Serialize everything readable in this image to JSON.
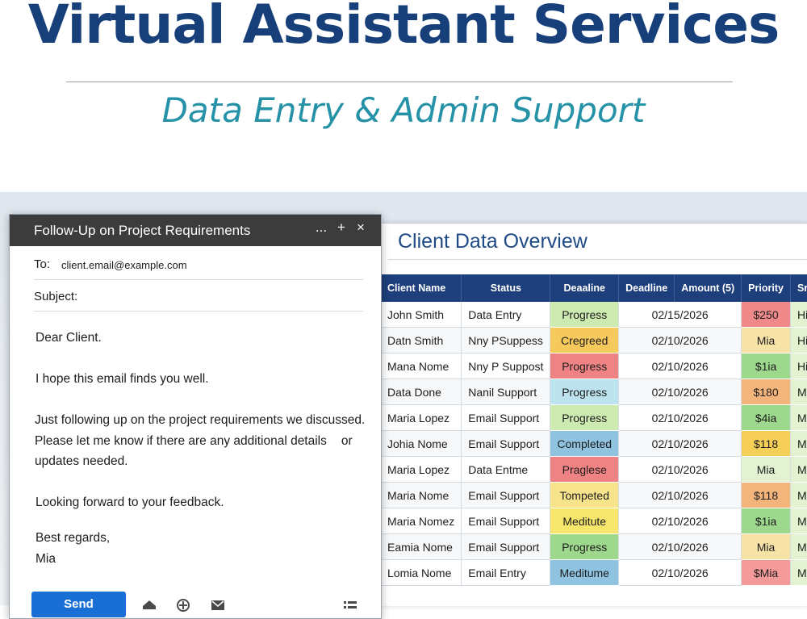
{
  "hero": {
    "title": "Virtual Assistant Services",
    "subtitle": "Data Entry & Admin Support"
  },
  "email": {
    "window_title": "Follow-Up on Project Requirements",
    "controls": {
      "minimize": "...",
      "expand": "+",
      "close": "×"
    },
    "to_label": "To:",
    "to_value": "client.email@example.com",
    "subject_label": "Subject:",
    "subject_value": "",
    "body": {
      "greeting": "Dear Client.",
      "para1": "I hope this email finds you well.",
      "para2_line1": "Just following up on the project requirements we discussed.",
      "para2_line2": "Please let me know if there are any additional details",
      "para2_or": "or",
      "para2_line3": "updates needed.",
      "para3": "Looking forward to your feedback.",
      "closing": "Best regards,",
      "signature": "Mia"
    },
    "send_label": "Send",
    "toolbar_icons": [
      "format-icon",
      "attach-icon",
      "image-icon",
      "more-icon"
    ]
  },
  "sheet": {
    "title": "Client Data Overview",
    "columns": [
      "Client Name",
      "Status",
      "Deaaline",
      "Deadline",
      "Amount (5)",
      "Priority",
      "Srion"
    ],
    "rows": [
      {
        "name": "John Smith",
        "service": "Data Entry",
        "status": "Progress",
        "status_color": "#cdeab0",
        "date": "02/15/2026",
        "amount": "$250",
        "amount_color": "#f08a8a",
        "priority": "Hig",
        "priority_color": "#e3f3d2"
      },
      {
        "name": "Datn Smith",
        "service": "Nny PSuppess",
        "status": "Cregreed",
        "status_color": "#f6c95c",
        "date": "02/10/2026",
        "amount": "Mia",
        "amount_color": "#f7e3a6",
        "priority": "Hig",
        "priority_color": "#e3f3d2"
      },
      {
        "name": "Mana Nome",
        "service": "Nny P Suppost",
        "status": "Progress",
        "status_color": "#ef8383",
        "date": "02/10/2026",
        "amount": "$1ia",
        "amount_color": "#9ed88c",
        "priority": "Hig",
        "priority_color": "#e3f3d2"
      },
      {
        "name": "Data Done",
        "service": "Nanil Support",
        "status": "Progress",
        "status_color": "#bde3ef",
        "date": "02/10/2026",
        "amount": "$180",
        "amount_color": "#f4b57d",
        "priority": "Mig",
        "priority_color": "#e3f3d2"
      },
      {
        "name": "Maria Lopez",
        "service": "Email Support",
        "status": "Progress",
        "status_color": "#cdeab0",
        "date": "02/10/2026",
        "amount": "$4ia",
        "amount_color": "#9ed88c",
        "priority": "Mi",
        "priority_color": "#e3f3d2"
      },
      {
        "name": "Johia Nome",
        "service": "Email Support",
        "status": "Completed",
        "status_color": "#8fc3e0",
        "date": "02/10/2026",
        "amount": "$118",
        "amount_color": "#f6cf59",
        "priority": "Mig",
        "priority_color": "#e3f3d2"
      },
      {
        "name": "Maria Lopez",
        "service": "Data Entme",
        "status": "Praglese",
        "status_color": "#ef8383",
        "date": "02/10/2026",
        "amount": "Mia",
        "amount_color": "#e3f3d2",
        "priority": "Mig",
        "priority_color": "#e3f3d2"
      },
      {
        "name": "Maria Nome",
        "service": "Email Support",
        "status": "Tompeted",
        "status_color": "#f6e38c",
        "date": "02/10/2026",
        "amount": "$118",
        "amount_color": "#f4b57d",
        "priority": "Mi",
        "priority_color": "#e3f3d2"
      },
      {
        "name": "Maria Nomez",
        "service": "Email Support",
        "status": "Meditute",
        "status_color": "#f6e66c",
        "date": "02/10/2026",
        "amount": "$1ia",
        "amount_color": "#9ed88c",
        "priority": "Mi",
        "priority_color": "#e3f3d2"
      },
      {
        "name": "Eamia Nome",
        "service": "Email Support",
        "status": "Progress",
        "status_color": "#9ed88c",
        "date": "02/10/2026",
        "amount": "Mia",
        "amount_color": "#f7e3a6",
        "priority": "Mig",
        "priority_color": "#e3f3d2"
      },
      {
        "name": "Lomia Nome",
        "service": "Email Entry",
        "status": "Meditume",
        "status_color": "#8fc3e0",
        "date": "02/10/2026",
        "amount": "$Mia",
        "amount_color": "#f49a9a",
        "priority": "Mig",
        "priority_color": "#e3f3d2"
      }
    ]
  }
}
